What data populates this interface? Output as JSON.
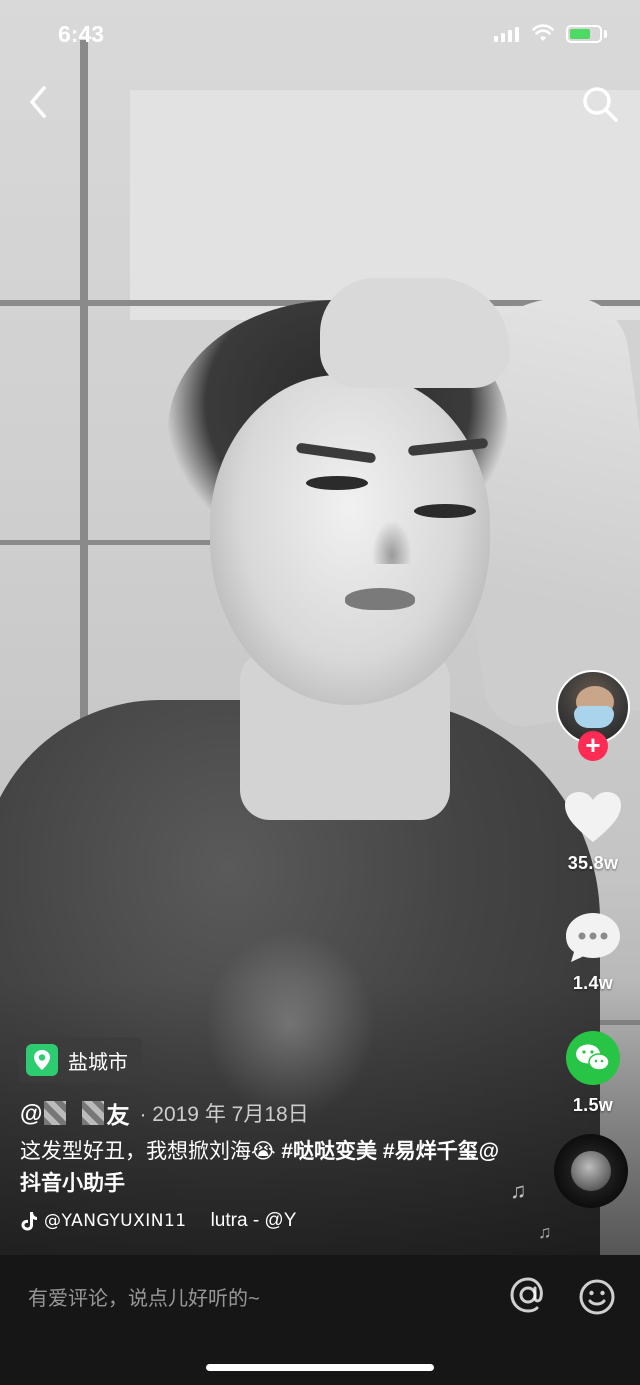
{
  "status_bar": {
    "time": "6:43"
  },
  "icons": {
    "back": "chevron-left-icon",
    "search": "search-icon",
    "like": "heart-icon",
    "comment": "comment-bubble-icon",
    "share": "wechat-icon",
    "location": "map-pin-icon",
    "music": "music-note-icon",
    "at": "at-sign-icon",
    "emoji": "smiley-icon"
  },
  "colors": {
    "follow": "#fe2c55",
    "wechat": "#28c445",
    "location": "#2ecc71"
  },
  "actions": {
    "follow_symbol": "+",
    "like_count": "35.8w",
    "comment_count": "1.4w",
    "share_count": "1.5w"
  },
  "post": {
    "location": "盐城市",
    "author_prefix": "@",
    "author_suffix": "友",
    "date": "· 2019 年 7月18日",
    "caption_text": "这发型好丑，我想掀刘海😭 ",
    "hashtag1": "#哒哒变美",
    "hashtag2": "#易烊千玺",
    "mention": "@抖音小助手",
    "music_source": "@YANGYUXIN11",
    "music_title": "lutra - @Y"
  },
  "comment_bar": {
    "placeholder": "有爱评论，说点儿好听的~"
  }
}
